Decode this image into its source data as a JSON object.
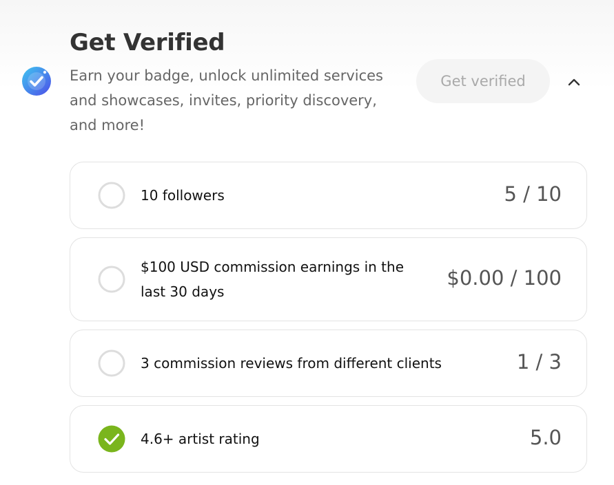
{
  "header": {
    "title": "Get Verified",
    "description": "Earn your badge, unlock unlimited services and showcases, invites, priority discovery, and more!",
    "badge_icon": "verified-badge-icon",
    "cta_label": "Get verified",
    "collapse_icon": "chevron-up-icon"
  },
  "requirements": [
    {
      "label": "10 followers",
      "progress": "5 / 10",
      "completed": false
    },
    {
      "label": "$100 USD commission earnings in the last 30 days",
      "progress": "$0.00 / 100",
      "completed": false
    },
    {
      "label": "3 commission reviews from different clients",
      "progress": "1 / 3",
      "completed": false
    },
    {
      "label": "4.6+ artist rating",
      "progress": "5.0",
      "completed": true
    }
  ],
  "colors": {
    "completed_green": "#7ab51d",
    "badge_blue": "#4a6cf0",
    "pending_circle": "#dddddd"
  }
}
